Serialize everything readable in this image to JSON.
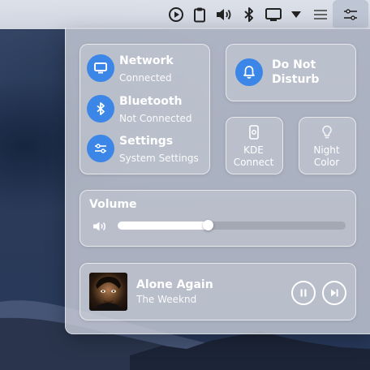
{
  "colors": {
    "accent": "#3b86e6",
    "panel": "#cdd1dc"
  },
  "tray": {
    "icons": [
      "play-circle-icon",
      "clipboard-icon",
      "volume-icon",
      "bluetooth-icon",
      "display-icon",
      "triangle-down-icon",
      "hamburger-menu-icon",
      "sliders-icon"
    ]
  },
  "tiles": {
    "network": {
      "title": "Network",
      "subtitle": "Connected",
      "icon": "network-icon"
    },
    "bluetooth": {
      "title": "Bluetooth",
      "subtitle": "Not Connected",
      "icon": "bluetooth-icon"
    },
    "settings": {
      "title": "Settings",
      "subtitle": "System Settings",
      "icon": "settings-sliders-icon"
    },
    "dnd": {
      "title_line1": "Do Not",
      "title_line2": "Disturb",
      "icon": "bell-icon"
    },
    "kde": {
      "line1": "KDE",
      "line2": "Connect",
      "icon": "phone-icon"
    },
    "night": {
      "line1": "Night",
      "line2": "Color",
      "icon": "bulb-icon"
    }
  },
  "volume": {
    "label": "Volume",
    "level": 0.4,
    "icon": "speaker-icon"
  },
  "media": {
    "title": "Alone Again",
    "artist": "The Weeknd",
    "controls": [
      "pause-icon",
      "skip-next-icon"
    ]
  }
}
